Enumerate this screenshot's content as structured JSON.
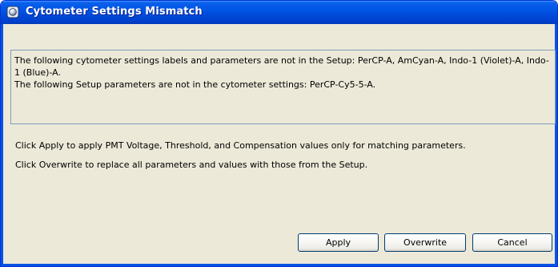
{
  "dialog": {
    "title": "Cytometer Settings Mismatch",
    "message_lines": [
      "The following cytometer settings labels and parameters are not in the Setup: PerCP-A, AmCyan-A, Indo-1 (Violet)-A, Indo-1 (Blue)-A.",
      "The following Setup parameters are not in the cytometer settings: PerCP-Cy5-5-A."
    ],
    "apply_info": "Click Apply to apply PMT Voltage, Threshold, and Compensation values only for matching parameters.",
    "overwrite_info": "Click Overwrite to replace all parameters and values with those from the Setup."
  },
  "buttons": {
    "apply": "Apply",
    "overwrite": "Overwrite",
    "cancel": "Cancel"
  },
  "colors": {
    "titlebar": "#0055e5",
    "dialog_background": "#ece9d8",
    "button_border": "#003c74"
  },
  "icons": {
    "title": "application-icon"
  }
}
